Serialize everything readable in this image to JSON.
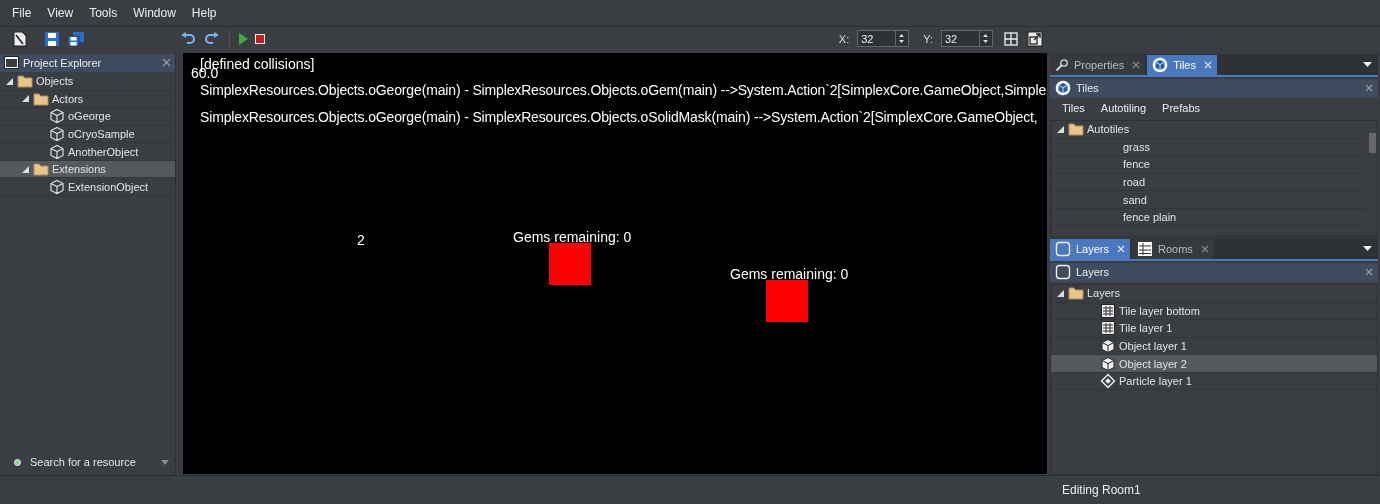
{
  "menu": [
    "File",
    "View",
    "Tools",
    "Window",
    "Help"
  ],
  "toolbar": {
    "x_label": "X:",
    "x_value": "32",
    "y_label": "Y:",
    "y_value": "32"
  },
  "project_explorer": {
    "title": "Project Explorer",
    "tree": [
      {
        "label": "Objects",
        "kind": "folder",
        "expanded": true,
        "selected": false,
        "children": [
          {
            "label": "Actors",
            "kind": "folder",
            "expanded": true,
            "selected": false,
            "children": [
              {
                "label": "oGeorge",
                "kind": "object",
                "selected": false
              },
              {
                "label": "oCryoSample",
                "kind": "object",
                "selected": false
              },
              {
                "label": "AnotherObject",
                "kind": "object",
                "selected": false
              }
            ]
          },
          {
            "label": "Extensions",
            "kind": "folder",
            "expanded": true,
            "selected": true,
            "children": [
              {
                "label": "ExtensionObject",
                "kind": "object",
                "selected": false
              }
            ]
          }
        ]
      }
    ],
    "search": {
      "placeholder": "Search for a resource"
    }
  },
  "canvas": {
    "heading": "[defined collisions]",
    "fps": "60.0",
    "debug_lines": [
      "SimplexResources.Objects.oGeorge(main) - SimplexResources.Objects.oGem(main) -->System.Action`2[SimplexCore.GameObject,Simple",
      "SimplexResources.Objects.oGeorge(main) - SimplexResources.Objects.oSolidMask(main) -->System.Action`2[SimplexCore.GameObject,"
    ],
    "counter": "2",
    "gems": [
      {
        "label": "Gems remaining: 0"
      },
      {
        "label": "Gems remaining: 0"
      }
    ]
  },
  "top_dock": {
    "tabs": [
      {
        "label": "Properties",
        "selected": false
      },
      {
        "label": "Tiles",
        "selected": true
      }
    ],
    "title": "Tiles",
    "subtabs": [
      "Tiles",
      "Autotiling",
      "Prefabs"
    ],
    "tree": [
      {
        "label": "Autotiles",
        "kind": "folder",
        "expanded": true,
        "selected": false,
        "children": [
          {
            "label": "grass",
            "kind": "plain",
            "selected": false
          },
          {
            "label": "fence",
            "kind": "plain",
            "selected": false
          },
          {
            "label": "road",
            "kind": "plain",
            "selected": false
          },
          {
            "label": "sand",
            "kind": "plain",
            "selected": false
          },
          {
            "label": "fence plain",
            "kind": "plain",
            "selected": false
          }
        ]
      }
    ]
  },
  "bottom_dock": {
    "tabs": [
      {
        "label": "Layers",
        "selected": true
      },
      {
        "label": "Rooms",
        "selected": false
      }
    ],
    "title": "Layers",
    "tree": [
      {
        "label": "Layers",
        "kind": "folder",
        "expanded": true,
        "selected": false,
        "children": [
          {
            "label": "Tile layer bottom",
            "kind": "tile",
            "selected": false
          },
          {
            "label": "Tile layer 1",
            "kind": "tile",
            "selected": false
          },
          {
            "label": "Object layer 1",
            "kind": "objlayer",
            "selected": false
          },
          {
            "label": "Object layer 2",
            "kind": "objlayer",
            "selected": true
          },
          {
            "label": "Particle layer 1",
            "kind": "particle",
            "selected": false
          }
        ]
      }
    ]
  },
  "status_bar": {
    "text": "Editing Room1"
  }
}
